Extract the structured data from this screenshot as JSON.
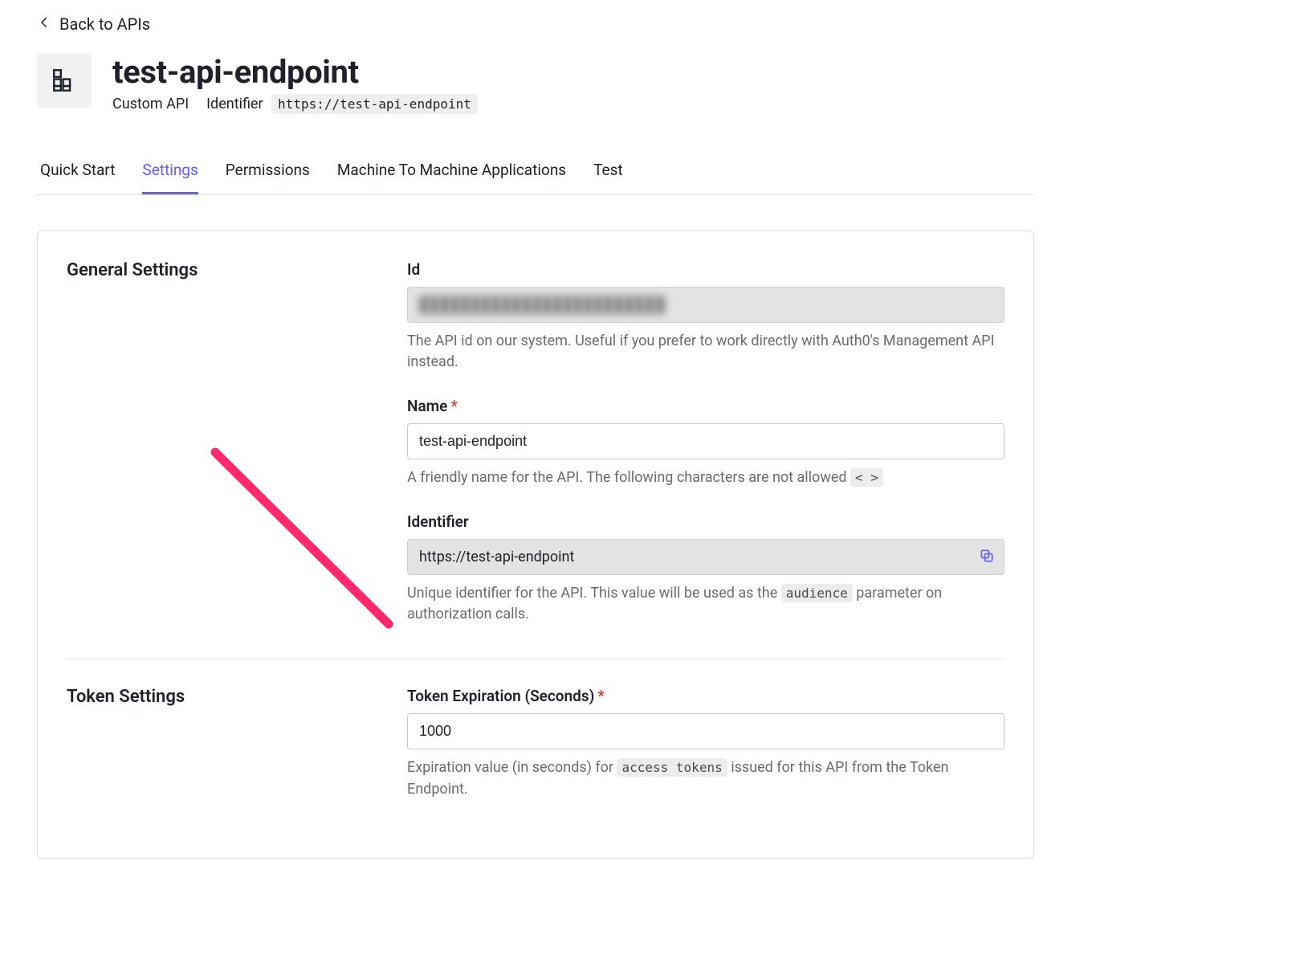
{
  "back_link": {
    "label": "Back to APIs"
  },
  "header": {
    "title": "test-api-endpoint",
    "type_label": "Custom API",
    "identifier_label": "Identifier",
    "identifier_value": "https://test-api-endpoint"
  },
  "tabs": [
    {
      "label": "Quick Start",
      "active": false
    },
    {
      "label": "Settings",
      "active": true
    },
    {
      "label": "Permissions",
      "active": false
    },
    {
      "label": "Machine To Machine Applications",
      "active": false
    },
    {
      "label": "Test",
      "active": false
    }
  ],
  "sections": {
    "general": {
      "title": "General Settings",
      "fields": {
        "id": {
          "label": "Id",
          "value": "████████████████████████",
          "help": "The API id on our system. Useful if you prefer to work directly with Auth0's Management API instead."
        },
        "name": {
          "label": "Name",
          "required": true,
          "value": "test-api-endpoint",
          "help_prefix": "A friendly name for the API. The following characters are not allowed ",
          "help_code": "< >"
        },
        "identifier": {
          "label": "Identifier",
          "value": "https://test-api-endpoint",
          "help_prefix": "Unique identifier for the API. This value will be used as the ",
          "help_code": "audience",
          "help_suffix": " parameter on authorization calls."
        }
      }
    },
    "token": {
      "title": "Token Settings",
      "fields": {
        "expiration": {
          "label": "Token Expiration (Seconds)",
          "required": true,
          "value": "1000",
          "help_prefix": "Expiration value (in seconds) for ",
          "help_code": "access tokens",
          "help_suffix": " issued for this API from the Token Endpoint."
        }
      }
    }
  },
  "annotation": {
    "arrow_color": "#ff2a6d"
  }
}
